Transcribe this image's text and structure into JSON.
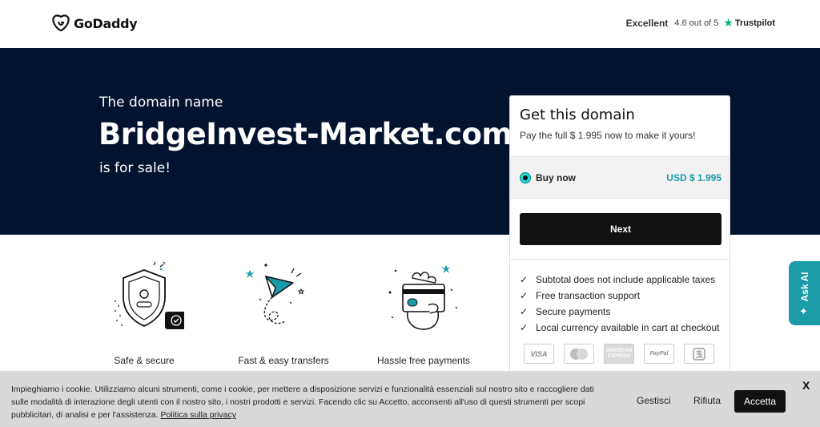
{
  "header": {
    "logo_text": "GoDaddy",
    "rating_label": "Excellent",
    "rating_score": "4.6 out of 5",
    "trustpilot_label": "Trustpilot"
  },
  "hero": {
    "intro": "The domain name",
    "domain": "BridgeInvest-Market.com",
    "suffix": "is for sale!"
  },
  "card": {
    "title": "Get this domain",
    "subtitle": "Pay the full $ 1.995 now to make it yours!",
    "option_label": "Buy now",
    "option_price": "USD $ 1.995",
    "next_label": "Next",
    "features": [
      "Subtotal does not include applicable taxes",
      "Free transaction support",
      "Secure payments",
      "Local currency available in cart at checkout"
    ],
    "payments": [
      "VISA",
      "mastercard",
      "AMERICAN EXPRESS",
      "PayPal",
      "alipay"
    ],
    "payment_visa": "VISA",
    "payment_amex": "AMERICAN EXPRESS",
    "payment_paypal": "PayPal"
  },
  "benefits": {
    "safe": "Safe & secure",
    "fast": "Fast & easy transfers",
    "hassle": "Hassle free payments"
  },
  "ask_ai": {
    "label": "Ask AI"
  },
  "cookie": {
    "text": "Impieghiamo i cookie. Utilizziamo alcuni strumenti, come i cookie, per mettere a disposizione servizi e funzionalità essenziali sul nostro sito e raccogliere dati sulle modalità di interazione degli utenti con il nostro sito, i nostri prodotti e servizi. Facendo clic su Accetto, acconsenti all'uso di questi strumenti per scopi pubblicitari, di analisi e per l'assistenza.",
    "privacy_link": "Politica sulla privacy",
    "manage_label": "Gestisci",
    "reject_label": "Rifiuta",
    "accept_label": "Accetta",
    "close_label": "X"
  },
  "colors": {
    "hero_bg": "#02132f",
    "accent_teal": "#1b9aa8",
    "trustpilot_green": "#00b67a",
    "button_dark": "#111111"
  }
}
